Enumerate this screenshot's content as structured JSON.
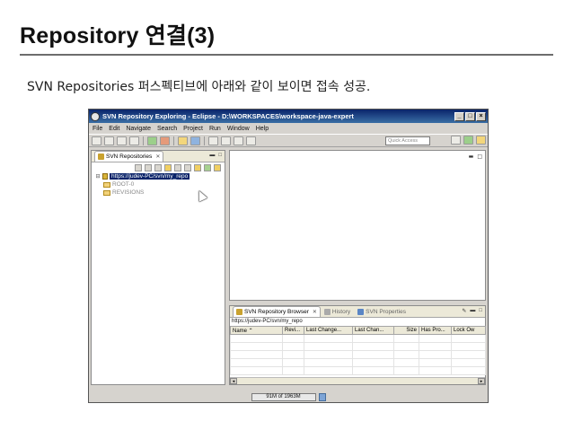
{
  "slide": {
    "title": "Repository 연결(3)",
    "subtitle": "SVN Repositories 퍼스펙티브에 아래와 같이 보이면 접속 성공."
  },
  "window": {
    "title": "SVN Repository Exploring - Eclipse - D:\\WORKSPACES\\workspace-java-expert",
    "controls": {
      "minimize": "_",
      "maximize": "□",
      "close": "×"
    }
  },
  "menu": [
    "File",
    "Edit",
    "Navigate",
    "Search",
    "Project",
    "Run",
    "Window",
    "Help"
  ],
  "toolbar": {
    "quick_access_placeholder": "Quick Access"
  },
  "repos_view": {
    "tab_label": "SVN Repositories",
    "tree": {
      "root_url": "https://judev-PC/svn/my_repo",
      "children": [
        "ROOT-0",
        "REVISIONS"
      ]
    }
  },
  "browser_view": {
    "tabs": [
      {
        "label": "SVN Repository Browser"
      },
      {
        "label": "History"
      },
      {
        "label": "SVN Properties"
      }
    ],
    "url": "https://judev-PC/svn/my_repo",
    "columns": [
      "Name",
      "Revi...",
      "Last Change...",
      "Last Chan...",
      "Size",
      "Has Pro...",
      "Lock Ow"
    ]
  },
  "status": {
    "heap": "91M of 1963M"
  }
}
